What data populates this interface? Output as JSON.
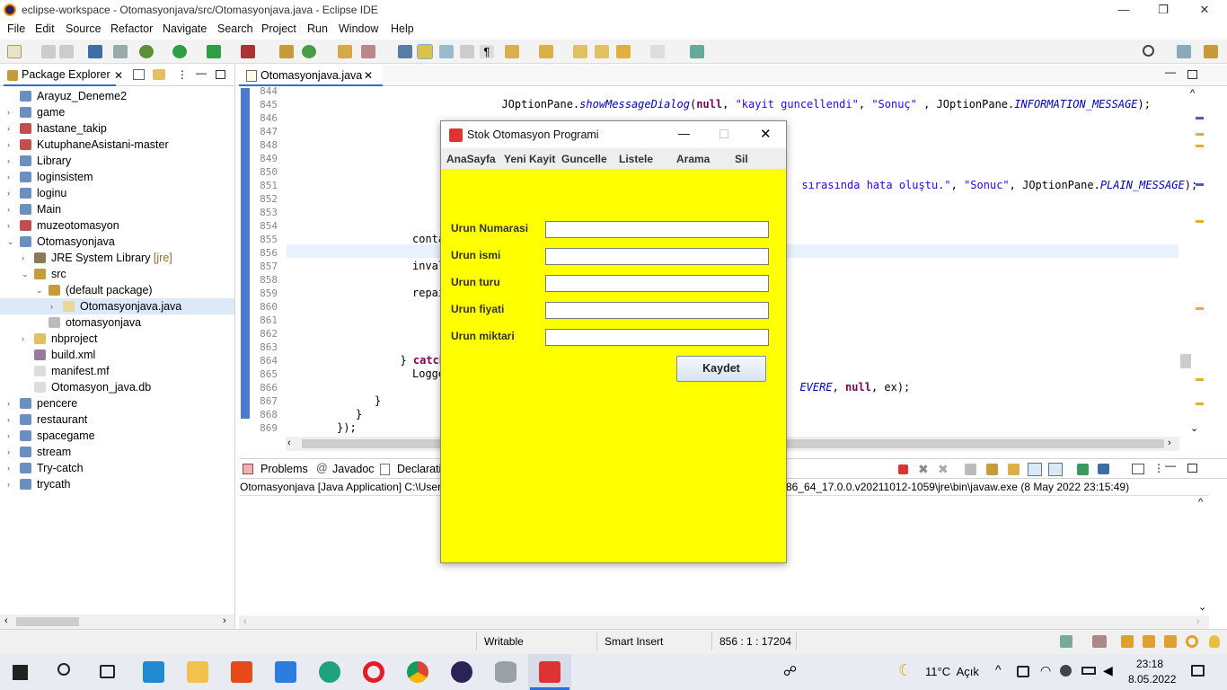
{
  "window": {
    "title": "eclipse-workspace - Otomasyonjava/src/Otomasyonjava.java - Eclipse IDE",
    "minimize": "—",
    "maximize": "❐",
    "close": "✕"
  },
  "menubar": [
    "File",
    "Edit",
    "Source",
    "Refactor",
    "Navigate",
    "Search",
    "Project",
    "Run",
    "Window",
    "Help"
  ],
  "package_explorer": {
    "tab_label": "Package Explorer",
    "items": [
      {
        "label": "Arayuz_Deneme2",
        "indent": 0,
        "expand": "",
        "icon": "project-icon",
        "selected": false
      },
      {
        "label": "game",
        "indent": 0,
        "expand": "›",
        "icon": "project-icon",
        "selected": false
      },
      {
        "label": "hastane_takip",
        "indent": 0,
        "expand": "›",
        "icon": "project-error-icon",
        "selected": false
      },
      {
        "label": "KutuphaneAsistani-master",
        "indent": 0,
        "expand": "›",
        "icon": "project-error-icon",
        "selected": false
      },
      {
        "label": "Library",
        "indent": 0,
        "expand": "›",
        "icon": "project-icon",
        "selected": false
      },
      {
        "label": "loginsistem",
        "indent": 0,
        "expand": "›",
        "icon": "project-icon",
        "selected": false
      },
      {
        "label": "loginu",
        "indent": 0,
        "expand": "›",
        "icon": "project-icon",
        "selected": false
      },
      {
        "label": "Main",
        "indent": 0,
        "expand": "›",
        "icon": "project-icon",
        "selected": false
      },
      {
        "label": "muzeotomasyon",
        "indent": 0,
        "expand": "›",
        "icon": "project-error-icon",
        "selected": false
      },
      {
        "label": "Otomasyonjava",
        "indent": 0,
        "expand": "⌄",
        "icon": "project-icon",
        "selected": false
      },
      {
        "label": "JRE System Library",
        "suffix": " [jre]",
        "indent": 1,
        "expand": "›",
        "icon": "library-icon",
        "selected": false
      },
      {
        "label": "src",
        "indent": 1,
        "expand": "⌄",
        "icon": "source-folder-icon",
        "selected": false
      },
      {
        "label": "(default package)",
        "indent": 2,
        "expand": "⌄",
        "icon": "package-icon",
        "selected": false
      },
      {
        "label": "Otomasyonjava.java",
        "indent": 3,
        "expand": "›",
        "icon": "java-file-icon",
        "selected": true
      },
      {
        "label": "otomasyonjava",
        "indent": 2,
        "expand": "",
        "icon": "package-empty-icon",
        "selected": false
      },
      {
        "label": "nbproject",
        "indent": 1,
        "expand": "›",
        "icon": "folder-icon",
        "selected": false
      },
      {
        "label": "build.xml",
        "indent": 1,
        "expand": "",
        "icon": "xml-file-icon",
        "selected": false
      },
      {
        "label": "manifest.mf",
        "indent": 1,
        "expand": "",
        "icon": "file-icon",
        "selected": false
      },
      {
        "label": "Otomasyon_java.db",
        "indent": 1,
        "expand": "",
        "icon": "file-icon",
        "selected": false
      },
      {
        "label": "pencere",
        "indent": 0,
        "expand": "›",
        "icon": "project-icon",
        "selected": false
      },
      {
        "label": "restaurant",
        "indent": 0,
        "expand": "›",
        "icon": "project-icon",
        "selected": false
      },
      {
        "label": "spacegame",
        "indent": 0,
        "expand": "›",
        "icon": "project-icon",
        "selected": false
      },
      {
        "label": "stream",
        "indent": 0,
        "expand": "›",
        "icon": "project-icon",
        "selected": false
      },
      {
        "label": "Try-catch",
        "indent": 0,
        "expand": "›",
        "icon": "project-icon",
        "selected": false
      },
      {
        "label": "trycath",
        "indent": 0,
        "expand": "›",
        "icon": "project-icon",
        "selected": false
      }
    ]
  },
  "editor": {
    "tab_label": "Otomasyonjava.java",
    "line_numbers": [
      "844",
      "845",
      "846",
      "847",
      "848",
      "849",
      "850",
      "851",
      "852",
      "853",
      "854",
      "855",
      "856",
      "857",
      "858",
      "859",
      "860",
      "861",
      "862",
      "863",
      "864",
      "865",
      "866",
      "867",
      "868",
      "869"
    ],
    "code": {
      "l844_a": "JOptionPane.",
      "l844_b": "showMessageDialog",
      "l844_c": "(",
      "l844_null": "null",
      "l844_d": ", ",
      "l844_s1": "\"kayit guncellendi\"",
      "l844_e": ", ",
      "l844_s2": "\"Sonuç\"",
      "l844_f": " , JOptionPane.",
      "l844_g": "INFORMATION_MESSAGE",
      "l844_h": ");",
      "l850_s": "sırasında hata oluştu.\"",
      "l850_a": ", ",
      "l850_s2": "\"Sonuc\"",
      "l850_b": ", JOptionPane.",
      "l850_c": "PLAIN_MESSAGE",
      "l850_d": ");",
      "l855": "conta",
      "l857": "inval",
      "l859": "repai",
      "l863_a": "} ",
      "l863_b": "catch",
      "l863_c": " (",
      "l865_a": "Logge",
      "l865_b": "EVERE",
      "l865_c": ", ",
      "l865_null": "null",
      "l865_d": ", ex);",
      "l867": "}",
      "l868": "}",
      "l869": "});"
    }
  },
  "console": {
    "tabs": [
      "Problems",
      "Javadoc",
      "Declaratio"
    ],
    "tab_icons": [
      "problems-icon",
      "javadoc-icon",
      "declaration-icon"
    ],
    "launch_left": "Otomasyonjava [Java Application] C:\\Users",
    "launch_right": "86_64_17.0.0.v20211012-1059\\jre\\bin\\javaw.exe  (8 May 2022 23:15:49)"
  },
  "statusbar": {
    "writable": "Writable",
    "insert_mode": "Smart Insert",
    "position": "856 : 1 : 17204"
  },
  "dialog": {
    "title": "Stok Otomasyon Programi",
    "menu": [
      "AnaSayfa",
      "Yeni Kayit",
      "Guncelle",
      "Listele",
      "Arama",
      "Sil"
    ],
    "fields": [
      {
        "label": "Urun Numarasi",
        "value": ""
      },
      {
        "label": "Urun ismi",
        "value": ""
      },
      {
        "label": "Urun turu",
        "value": ""
      },
      {
        "label": "Urun fiyati",
        "value": ""
      },
      {
        "label": "Urun miktari",
        "value": ""
      }
    ],
    "save_button": "Kaydet",
    "background": "#ffff00"
  },
  "taskbar": {
    "weather": "11°C  Açık",
    "time": "23:18",
    "date": "8.05.2022",
    "apps": [
      "windows-start-icon",
      "search-icon",
      "task-view-icon",
      "vscode-icon",
      "file-explorer-icon",
      "office-icon",
      "mail-icon",
      "edge-icon",
      "opera-icon",
      "chrome-icon",
      "eclipse-icon",
      "database-icon",
      "java-app-icon"
    ]
  },
  "colors": {
    "accent": "#2a6fdb",
    "selection": "#dbe9f9",
    "keyword": "#7f0055",
    "string": "#2a00ff",
    "constant": "#0000c0"
  }
}
